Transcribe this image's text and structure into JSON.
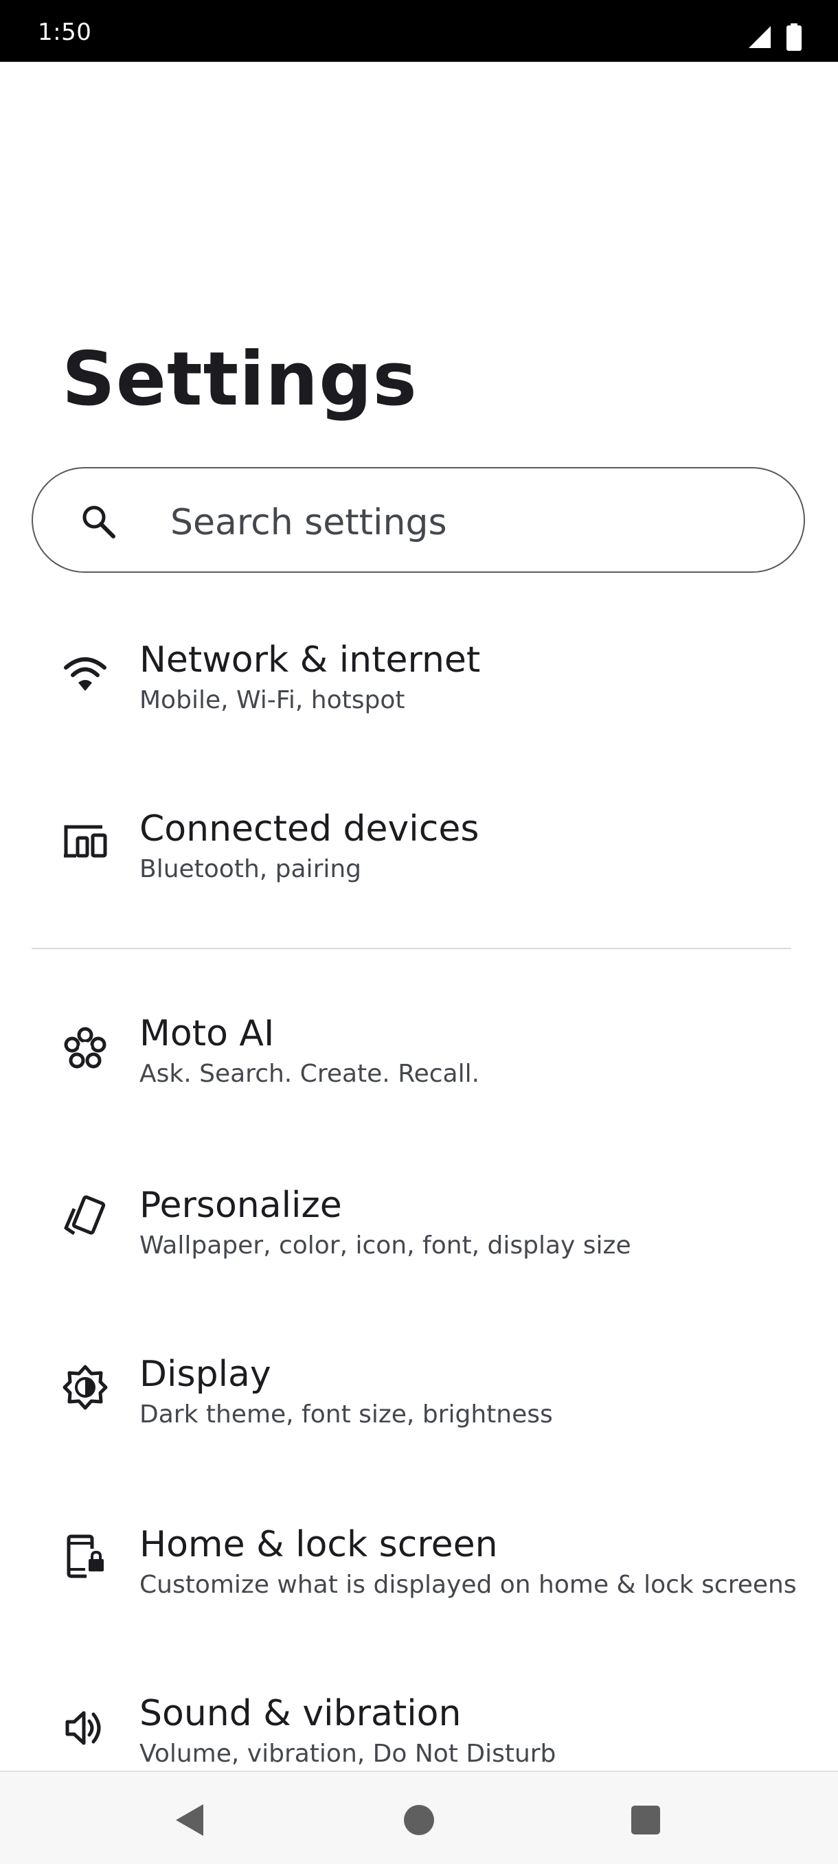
{
  "status_bar": {
    "time": "1:50",
    "icons": [
      "cell-signal-icon",
      "battery-icon"
    ]
  },
  "page": {
    "title": "Settings"
  },
  "search": {
    "placeholder": "Search settings",
    "icon": "search-icon"
  },
  "items": [
    {
      "title": "Network & internet",
      "subtitle": "Mobile, Wi-Fi, hotspot",
      "icon": "wifi-icon"
    },
    {
      "title": "Connected devices",
      "subtitle": "Bluetooth, pairing",
      "icon": "connected-devices-icon"
    },
    {
      "title": "Moto AI",
      "subtitle": "Ask. Search. Create. Recall.",
      "icon": "moto-ai-icon"
    },
    {
      "title": "Personalize",
      "subtitle": "Wallpaper, color, icon, font, display size",
      "icon": "personalize-icon"
    },
    {
      "title": "Display",
      "subtitle": "Dark theme, font size, brightness",
      "icon": "display-brightness-icon"
    },
    {
      "title": "Home & lock screen",
      "subtitle": "Customize what is displayed on home & lock screens",
      "icon": "phone-lock-icon"
    },
    {
      "title": "Sound & vibration",
      "subtitle": "Volume, vibration, Do Not Disturb",
      "icon": "speaker-icon"
    }
  ],
  "nav_bar": {
    "buttons": [
      "back-icon",
      "home-icon",
      "recents-icon"
    ]
  },
  "colors": {
    "text_primary": "#1c1b1f",
    "text_secondary": "#44474e",
    "status_bar_bg": "#000000",
    "nav_bar_bg": "#f7f7f7",
    "nav_icon": "#5f5f5f"
  }
}
